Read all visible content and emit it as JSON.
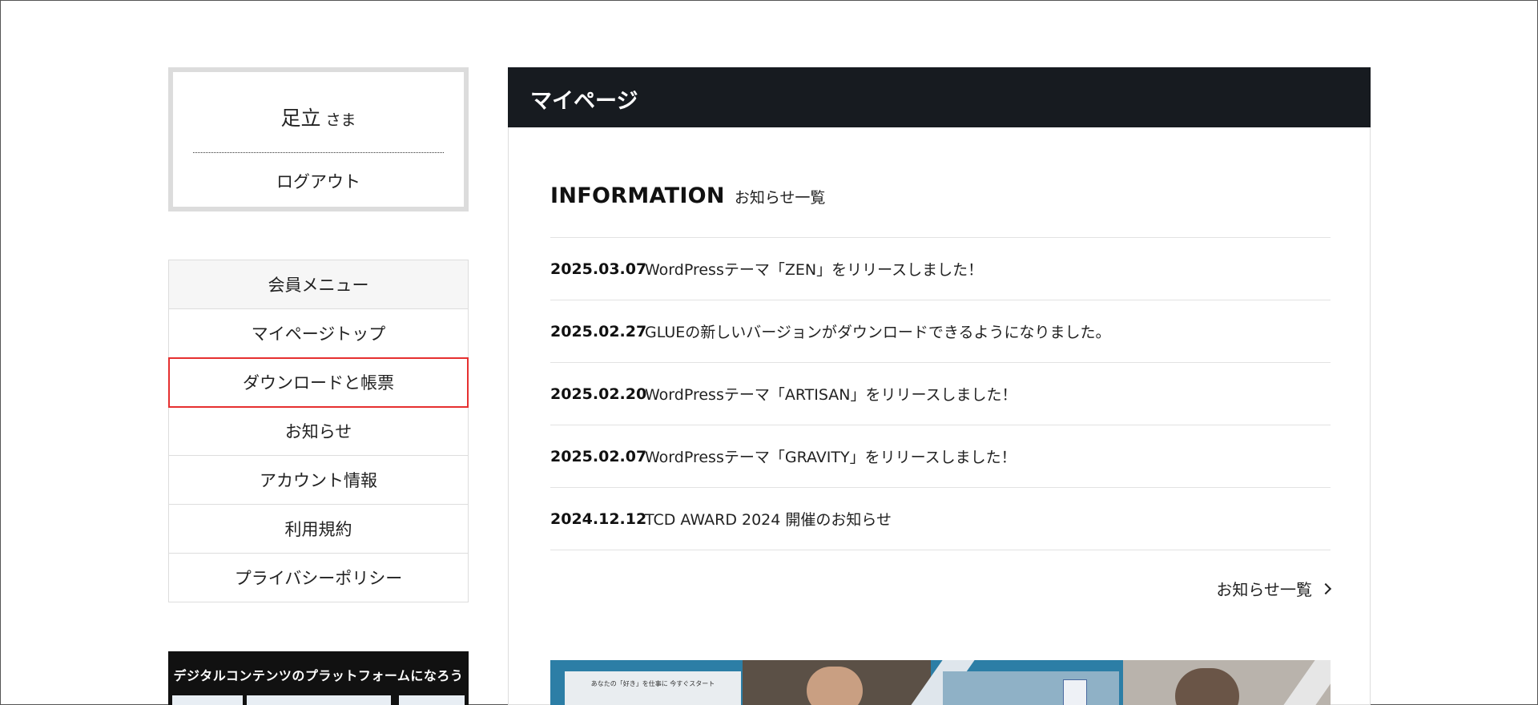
{
  "user": {
    "name": "足立",
    "honorific": "さま",
    "logout_label": "ログアウト"
  },
  "menu": {
    "header": "会員メニュー",
    "items": [
      {
        "label": "マイページトップ"
      },
      {
        "label": "ダウンロードと帳票"
      },
      {
        "label": "お知らせ"
      },
      {
        "label": "アカウント情報"
      },
      {
        "label": "利用規約"
      },
      {
        "label": "プライバシーポリシー"
      }
    ]
  },
  "banner": {
    "text": "デジタルコンテンツのプラットフォームになろう"
  },
  "main": {
    "title": "マイページ",
    "info_title_en": "INFORMATION",
    "info_title_ja": "お知らせ一覧",
    "news": [
      {
        "date": "2025.03.07",
        "text": "WordPressテーマ「ZEN」をリリースしました！"
      },
      {
        "date": "2025.02.27",
        "text": "GLUEの新しいバージョンがダウンロードできるようになりました。"
      },
      {
        "date": "2025.02.20",
        "text": "WordPressテーマ「ARTISAN」をリリースしました！"
      },
      {
        "date": "2025.02.07",
        "text": "WordPressテーマ「GRAVITY」をリリースしました！"
      },
      {
        "date": "2024.12.12",
        "text": "TCD AWARD 2024 開催のお知らせ"
      }
    ],
    "more_label": "お知らせ一覧",
    "banner_card_text": "あなたの「好き」を仕事に 今すぐスタート"
  },
  "colors": {
    "header_bg": "#171b20",
    "highlight": "#e63030",
    "menu_header_bg": "#f6f6f6"
  }
}
